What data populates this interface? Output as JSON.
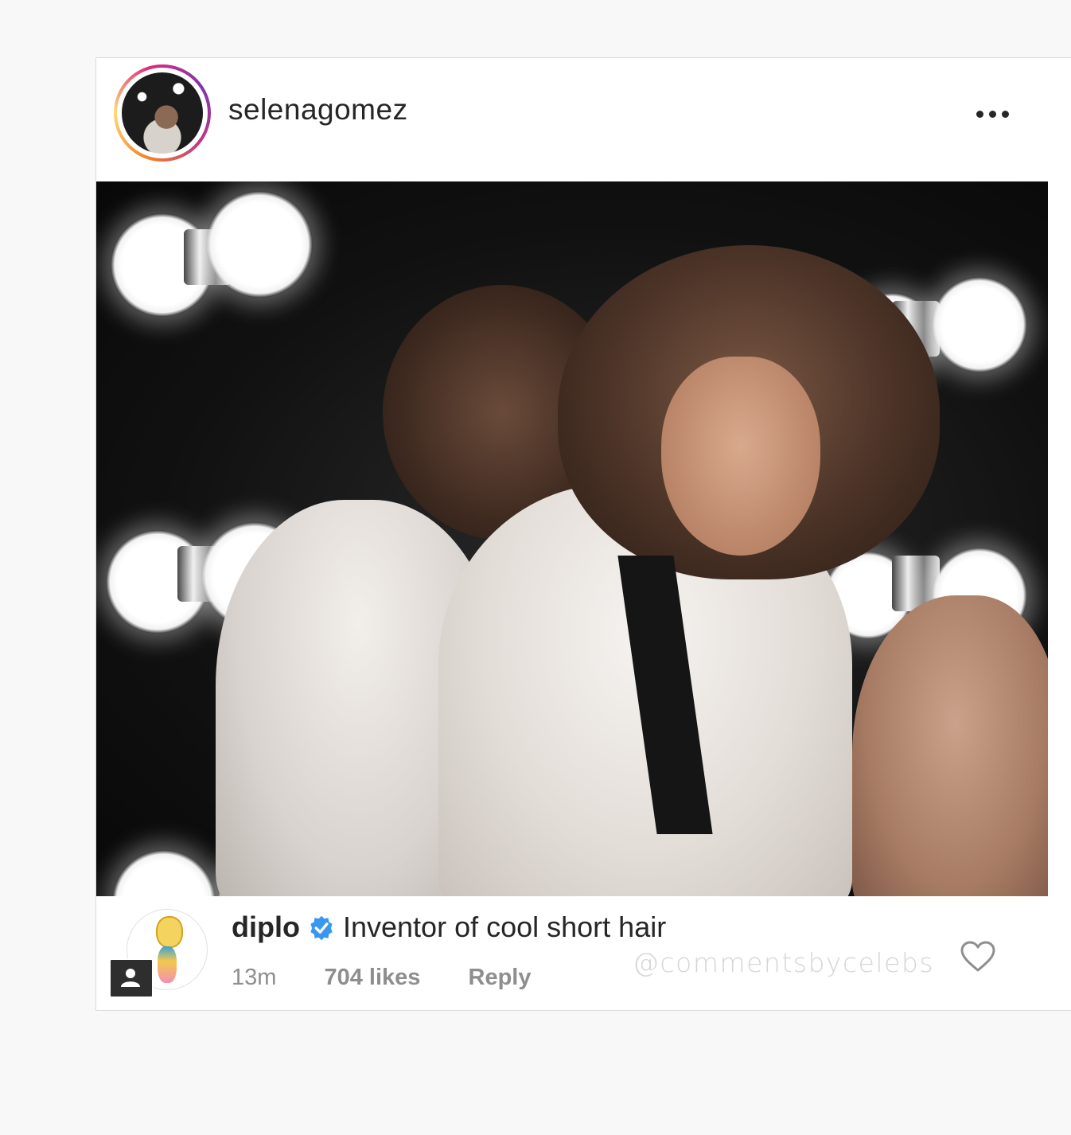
{
  "post": {
    "username": "selenagomez",
    "more_icon": "more-horizontal-icon"
  },
  "comment": {
    "username": "diplo",
    "verified": true,
    "text": "Inventor of cool short hair",
    "time": "13m",
    "likes": "704 likes",
    "reply_label": "Reply",
    "watermark": "@commentsbycelebs"
  },
  "colors": {
    "text_primary": "#262626",
    "text_secondary": "#8e8e8e",
    "verified_blue": "#3897f0",
    "background": "#f8f8f8"
  }
}
